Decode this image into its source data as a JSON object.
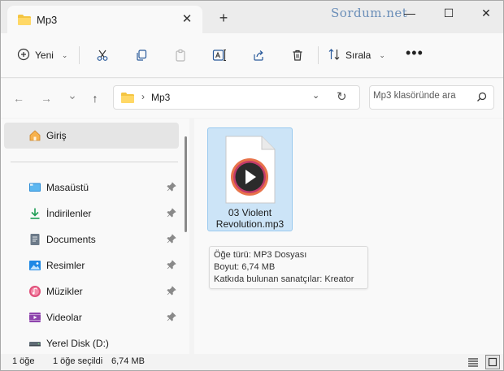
{
  "tab": {
    "title": "Mp3",
    "close_glyph": "✕",
    "new_glyph": "+"
  },
  "watermark": "Sordum.net",
  "window_controls": {
    "minimize": "—",
    "maximize": "☐",
    "close": "✕"
  },
  "toolbar": {
    "new_label": "Yeni",
    "sort_label": "Sırala",
    "more_glyph": "•••",
    "icons": [
      "cut-icon",
      "copy-icon",
      "paste-icon",
      "rename-icon",
      "share-icon",
      "delete-icon"
    ]
  },
  "address": {
    "path": "Mp3",
    "separator": "›",
    "nav_glyphs": {
      "back": "←",
      "forward": "→",
      "recent": "⌄",
      "up": "↑"
    }
  },
  "search": {
    "placeholder": "Mp3 klasöründe ara"
  },
  "sidebar": {
    "home": "Giriş",
    "items": [
      {
        "label": "Masaüstü",
        "icon": "desktop-icon",
        "pinned": true
      },
      {
        "label": "İndirilenler",
        "icon": "download-icon",
        "pinned": true
      },
      {
        "label": "Documents",
        "icon": "documents-icon",
        "pinned": true
      },
      {
        "label": "Resimler",
        "icon": "pictures-icon",
        "pinned": true
      },
      {
        "label": "Müzikler",
        "icon": "music-icon",
        "pinned": true
      },
      {
        "label": "Videolar",
        "icon": "videos-icon",
        "pinned": true
      },
      {
        "label": "Yerel Disk (D:)",
        "icon": "drive-icon",
        "pinned": false
      }
    ]
  },
  "file": {
    "name_line1": "03 Violent",
    "name_line2": "Revolution.mp3"
  },
  "tooltip": {
    "type": "Öğe türü: MP3 Dosyası",
    "size": "Boyut: 6,74 MB",
    "artists": "Katkıda bulunan sanatçılar: Kreator"
  },
  "status": {
    "count": "1 öğe",
    "selected": "1 öğe seçildi",
    "size": "6,74 MB"
  },
  "colors": {
    "accent": "#0067c0",
    "selection": "#cce4f7",
    "folder": "#f4c542"
  }
}
